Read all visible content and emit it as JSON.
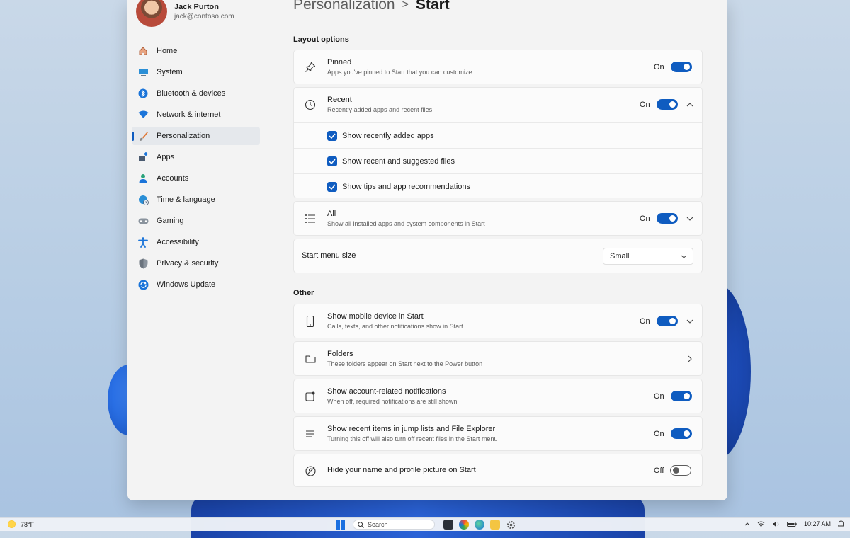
{
  "profile": {
    "name": "Jack Purton",
    "email": "jack@contoso.com"
  },
  "nav": {
    "items": [
      {
        "label": "Home",
        "icon": "home-icon"
      },
      {
        "label": "System",
        "icon": "system-icon"
      },
      {
        "label": "Bluetooth & devices",
        "icon": "bluetooth-icon"
      },
      {
        "label": "Network & internet",
        "icon": "wifi-icon"
      },
      {
        "label": "Personalization",
        "icon": "brush-icon",
        "active": true
      },
      {
        "label": "Apps",
        "icon": "apps-icon"
      },
      {
        "label": "Accounts",
        "icon": "person-icon"
      },
      {
        "label": "Time & language",
        "icon": "globe-clock-icon"
      },
      {
        "label": "Gaming",
        "icon": "gamepad-icon"
      },
      {
        "label": "Accessibility",
        "icon": "accessibility-icon"
      },
      {
        "label": "Privacy & security",
        "icon": "shield-icon"
      },
      {
        "label": "Windows Update",
        "icon": "update-icon"
      }
    ]
  },
  "breadcrumb": {
    "parent": "Personalization",
    "separator": ">",
    "current": "Start"
  },
  "sections": {
    "layout": "Layout options",
    "other": "Other"
  },
  "layout": {
    "pinned": {
      "title": "Pinned",
      "subtitle": "Apps you've pinned to Start that you can customize",
      "state": "On"
    },
    "recent": {
      "title": "Recent",
      "subtitle": "Recently added apps and recent files",
      "state": "On",
      "options": [
        "Show recently added apps",
        "Show recent and suggested files",
        "Show tips and app recommendations"
      ]
    },
    "all": {
      "title": "All",
      "subtitle": "Show all installed apps and system components in Start",
      "state": "On"
    },
    "size": {
      "title": "Start menu size",
      "value": "Small"
    }
  },
  "other": {
    "mobile": {
      "title": "Show mobile device in Start",
      "subtitle": "Calls, texts, and other notifications show in Start",
      "state": "On"
    },
    "folders": {
      "title": "Folders",
      "subtitle": "These folders appear on Start next to the Power button"
    },
    "account": {
      "title": "Show account-related notifications",
      "subtitle": "When off, required notifications are still shown",
      "state": "On"
    },
    "jumplists": {
      "title": "Show recent items in jump lists and File Explorer",
      "subtitle": "Turning this off will also turn off recent files in the Start menu",
      "state": "On"
    },
    "hide": {
      "title": "Hide your name and profile picture on Start",
      "state": "Off"
    }
  },
  "taskbar": {
    "weather": "78°F",
    "search": "Search",
    "time": "10:27 AM"
  },
  "colors": {
    "accent": "#0f5cc0"
  }
}
